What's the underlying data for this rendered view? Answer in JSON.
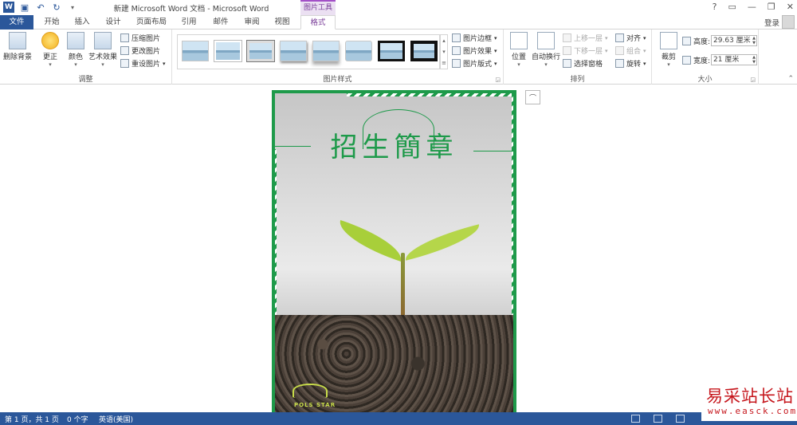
{
  "titlebar": {
    "title": "新建 Microsoft Word 文档 - Microsoft Word",
    "context_tool": "图片工具",
    "help": "?",
    "minimize": "—",
    "restore": "❐",
    "close": "✕"
  },
  "tabs": {
    "file": "文件",
    "items": [
      "开始",
      "插入",
      "设计",
      "页面布局",
      "引用",
      "邮件",
      "审阅",
      "视图",
      "格式"
    ],
    "active": "格式",
    "login": "登录"
  },
  "ribbon": {
    "adjust": {
      "label": "调整",
      "remove_bg": "删除背景",
      "corrections": "更正",
      "color": "颜色",
      "artistic": "艺术效果",
      "compress": "压缩图片",
      "change": "更改图片",
      "reset": "重设图片"
    },
    "styles": {
      "label": "图片样式",
      "border": "图片边框",
      "effects": "图片效果",
      "layout": "图片版式"
    },
    "arrange": {
      "label": "排列",
      "position": "位置",
      "wrap": "自动换行",
      "bring_forward": "上移一层",
      "send_backward": "下移一层",
      "selection_pane": "选择窗格",
      "align": "对齐",
      "group": "组合",
      "rotate": "旋转"
    },
    "size": {
      "label": "大小",
      "crop": "裁剪",
      "height_label": "高度:",
      "height_value": "29.63 厘米",
      "width_label": "宽度:",
      "width_value": "21 厘米"
    }
  },
  "document": {
    "headline": "招生簡章",
    "logo_text": "POLS STAR"
  },
  "statusbar": {
    "page": "第 1 页，共 1 页",
    "words": "0 个字",
    "language": "英语(美国)"
  },
  "watermark": {
    "title": "易采站长站",
    "url": "www.easck.com"
  },
  "colors": {
    "accent": "#2b579a",
    "context_purple": "#7a3d99",
    "frame_green": "#1e9a4a",
    "watermark_red": "#c6171d"
  }
}
